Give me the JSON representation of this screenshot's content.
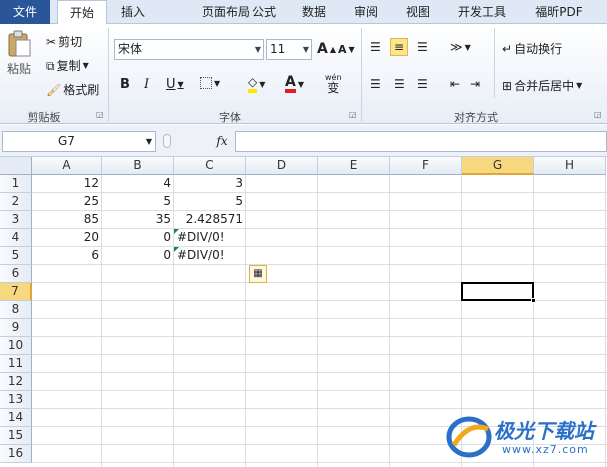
{
  "tabs": [
    "文件",
    "开始",
    "插入",
    "页面布局",
    "公式",
    "数据",
    "审阅",
    "视图",
    "开发工具",
    "福昕PDF"
  ],
  "clipboard": {
    "paste": "粘贴",
    "cut": "剪切",
    "copy": "复制",
    "format_painter": "格式刷",
    "group": "剪贴板"
  },
  "font": {
    "name": "宋体",
    "size": "11",
    "bold": "B",
    "italic": "I",
    "underline": "U",
    "grow": "A",
    "shrink": "A",
    "group": "字体",
    "wen": "wén",
    "wen_char": "变"
  },
  "alignment": {
    "wrap": "自动换行",
    "merge": "合并后居中",
    "group": "对齐方式"
  },
  "formula_bar": {
    "cell_ref": "G7",
    "fx": "fx",
    "formula": ""
  },
  "columns": [
    "A",
    "B",
    "C",
    "D",
    "E",
    "F",
    "G",
    "H"
  ],
  "selected_column": "G",
  "rows": [
    "1",
    "2",
    "3",
    "4",
    "5",
    "6",
    "7",
    "8",
    "9",
    "10",
    "11",
    "12",
    "13",
    "14",
    "15",
    "16"
  ],
  "selected_row": "7",
  "cells": [
    [
      "12",
      "4",
      "3"
    ],
    [
      "25",
      "5",
      "5"
    ],
    [
      "85",
      "35",
      "2.428571"
    ],
    [
      "20",
      "0",
      "#DIV/0!"
    ],
    [
      "6",
      "0",
      "#DIV/0!"
    ]
  ],
  "watermark": {
    "brand": "极光下载站",
    "url": "www.xz7.com"
  },
  "colors": {
    "file_tab": "#2a5699",
    "selected_header": "#f7d87e",
    "error_triangle": "#1d8a3a",
    "watermark": "#2c6fc9"
  }
}
